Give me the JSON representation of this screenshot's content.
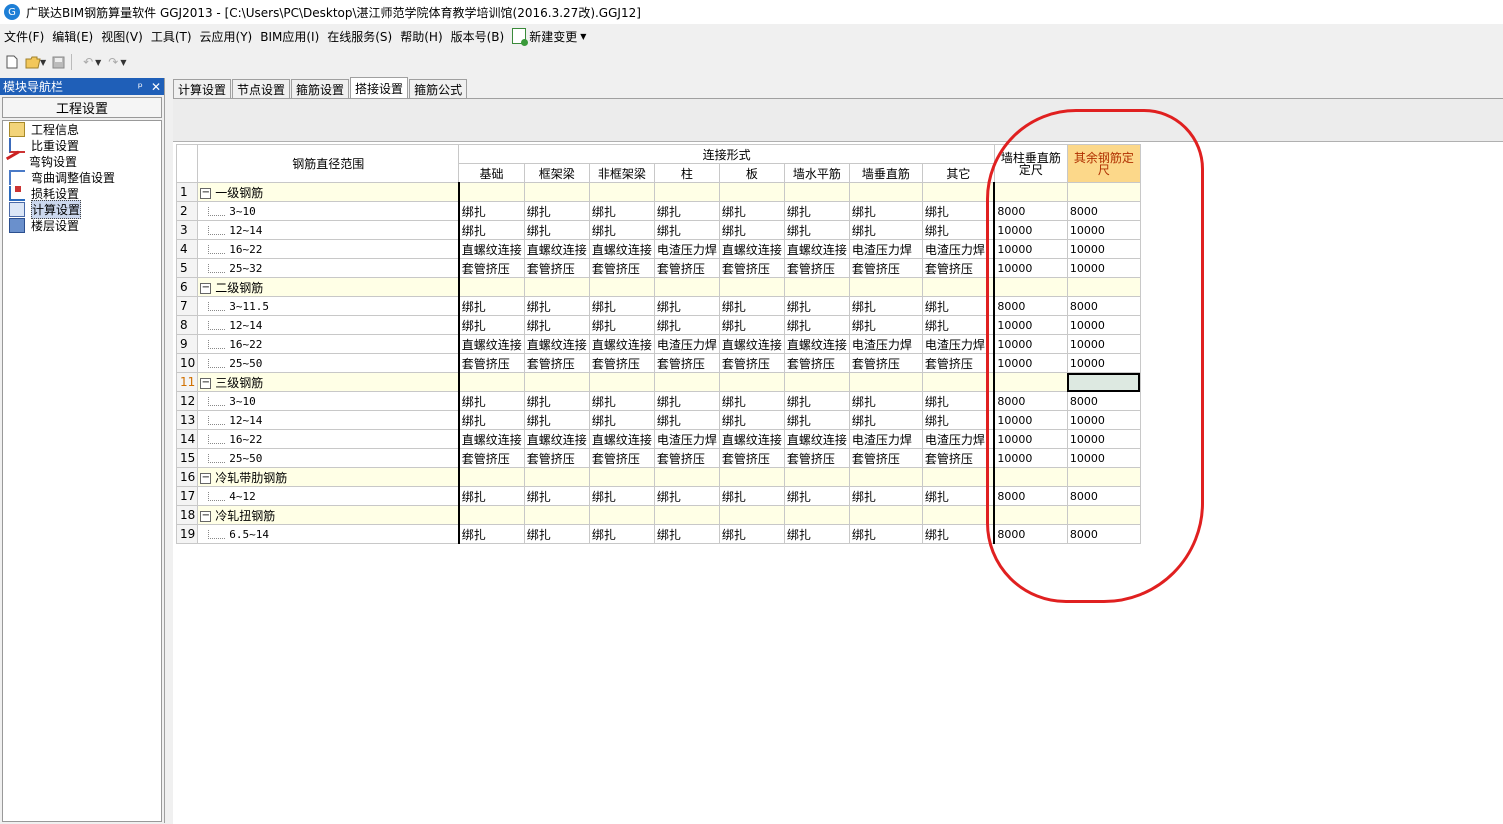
{
  "window": {
    "title": "广联达BIM钢筋算量软件 GGJ2013 - [C:\\Users\\PC\\Desktop\\湛江师范学院体育教学培训馆(2016.3.27改).GGJ12]",
    "app_icon_text": "G"
  },
  "menu": {
    "items": [
      "文件(F)",
      "编辑(E)",
      "视图(V)",
      "工具(T)",
      "云应用(Y)",
      "BIM应用(I)",
      "在线服务(S)",
      "帮助(H)",
      "版本号(B)"
    ],
    "new_change": "新建变更"
  },
  "toolbar": {
    "new_icon": "new-file-icon",
    "open_icon": "open-folder-icon",
    "save_icon": "save-icon",
    "undo_icon": "undo-icon",
    "redo_icon": "redo-icon"
  },
  "nav": {
    "title": "模块导航栏",
    "pin": "ᵖ",
    "close": "✕",
    "section": "工程设置",
    "items": [
      "工程信息",
      "比重设置",
      "弯钩设置",
      "弯曲调整值设置",
      "损耗设置",
      "计算设置",
      "楼层设置"
    ],
    "selected_index": 5
  },
  "tabs": [
    "计算设置",
    "节点设置",
    "箍筋设置",
    "搭接设置",
    "箍筋公式"
  ],
  "active_tab": 3,
  "table": {
    "header_range": "钢筋直径范围",
    "header_group": "连接形式",
    "cols": [
      "基础",
      "框架梁",
      "非框架梁",
      "柱",
      "板",
      "墙水平筋",
      "墙垂直筋",
      "其它"
    ],
    "col_wall_fixed": "墙柱垂直筋定尺",
    "col_other_fixed": "其余钢筋定尺",
    "rows": [
      {
        "n": "1",
        "group": true,
        "name": "一级钢筋",
        "v": [
          "",
          "",
          "",
          "",
          "",
          "",
          "",
          ""
        ],
        "a": "",
        "b": ""
      },
      {
        "n": "2",
        "group": false,
        "name": "3~10",
        "v": [
          "绑扎",
          "绑扎",
          "绑扎",
          "绑扎",
          "绑扎",
          "绑扎",
          "绑扎",
          "绑扎"
        ],
        "a": "8000",
        "b": "8000"
      },
      {
        "n": "3",
        "group": false,
        "name": "12~14",
        "v": [
          "绑扎",
          "绑扎",
          "绑扎",
          "绑扎",
          "绑扎",
          "绑扎",
          "绑扎",
          "绑扎"
        ],
        "a": "10000",
        "b": "10000"
      },
      {
        "n": "4",
        "group": false,
        "name": "16~22",
        "v": [
          "直螺纹连接",
          "直螺纹连接",
          "直螺纹连接",
          "电渣压力焊",
          "直螺纹连接",
          "直螺纹连接",
          "电渣压力焊",
          "电渣压力焊"
        ],
        "a": "10000",
        "b": "10000"
      },
      {
        "n": "5",
        "group": false,
        "name": "25~32",
        "v": [
          "套管挤压",
          "套管挤压",
          "套管挤压",
          "套管挤压",
          "套管挤压",
          "套管挤压",
          "套管挤压",
          "套管挤压"
        ],
        "a": "10000",
        "b": "10000"
      },
      {
        "n": "6",
        "group": true,
        "name": "二级钢筋",
        "v": [
          "",
          "",
          "",
          "",
          "",
          "",
          "",
          ""
        ],
        "a": "",
        "b": ""
      },
      {
        "n": "7",
        "group": false,
        "name": "3~11.5",
        "v": [
          "绑扎",
          "绑扎",
          "绑扎",
          "绑扎",
          "绑扎",
          "绑扎",
          "绑扎",
          "绑扎"
        ],
        "a": "8000",
        "b": "8000"
      },
      {
        "n": "8",
        "group": false,
        "name": "12~14",
        "v": [
          "绑扎",
          "绑扎",
          "绑扎",
          "绑扎",
          "绑扎",
          "绑扎",
          "绑扎",
          "绑扎"
        ],
        "a": "10000",
        "b": "10000"
      },
      {
        "n": "9",
        "group": false,
        "name": "16~22",
        "v": [
          "直螺纹连接",
          "直螺纹连接",
          "直螺纹连接",
          "电渣压力焊",
          "直螺纹连接",
          "直螺纹连接",
          "电渣压力焊",
          "电渣压力焊"
        ],
        "a": "10000",
        "b": "10000"
      },
      {
        "n": "10",
        "group": false,
        "name": "25~50",
        "v": [
          "套管挤压",
          "套管挤压",
          "套管挤压",
          "套管挤压",
          "套管挤压",
          "套管挤压",
          "套管挤压",
          "套管挤压"
        ],
        "a": "10000",
        "b": "10000"
      },
      {
        "n": "11",
        "group": true,
        "name": "三级钢筋",
        "v": [
          "",
          "",
          "",
          "",
          "",
          "",
          "",
          ""
        ],
        "a": "",
        "b": "",
        "selected": true
      },
      {
        "n": "12",
        "group": false,
        "name": "3~10",
        "v": [
          "绑扎",
          "绑扎",
          "绑扎",
          "绑扎",
          "绑扎",
          "绑扎",
          "绑扎",
          "绑扎"
        ],
        "a": "8000",
        "b": "8000"
      },
      {
        "n": "13",
        "group": false,
        "name": "12~14",
        "v": [
          "绑扎",
          "绑扎",
          "绑扎",
          "绑扎",
          "绑扎",
          "绑扎",
          "绑扎",
          "绑扎"
        ],
        "a": "10000",
        "b": "10000"
      },
      {
        "n": "14",
        "group": false,
        "name": "16~22",
        "v": [
          "直螺纹连接",
          "直螺纹连接",
          "直螺纹连接",
          "电渣压力焊",
          "直螺纹连接",
          "直螺纹连接",
          "电渣压力焊",
          "电渣压力焊"
        ],
        "a": "10000",
        "b": "10000"
      },
      {
        "n": "15",
        "group": false,
        "name": "25~50",
        "v": [
          "套管挤压",
          "套管挤压",
          "套管挤压",
          "套管挤压",
          "套管挤压",
          "套管挤压",
          "套管挤压",
          "套管挤压"
        ],
        "a": "10000",
        "b": "10000"
      },
      {
        "n": "16",
        "group": true,
        "name": "冷轧带肋钢筋",
        "v": [
          "",
          "",
          "",
          "",
          "",
          "",
          "",
          ""
        ],
        "a": "",
        "b": ""
      },
      {
        "n": "17",
        "group": false,
        "name": "4~12",
        "v": [
          "绑扎",
          "绑扎",
          "绑扎",
          "绑扎",
          "绑扎",
          "绑扎",
          "绑扎",
          "绑扎"
        ],
        "a": "8000",
        "b": "8000"
      },
      {
        "n": "18",
        "group": true,
        "name": "冷轧扭钢筋",
        "v": [
          "",
          "",
          "",
          "",
          "",
          "",
          "",
          ""
        ],
        "a": "",
        "b": ""
      },
      {
        "n": "19",
        "group": false,
        "name": "6.5~14",
        "v": [
          "绑扎",
          "绑扎",
          "绑扎",
          "绑扎",
          "绑扎",
          "绑扎",
          "绑扎",
          "绑扎"
        ],
        "a": "8000",
        "b": "8000"
      }
    ]
  },
  "colors": {
    "nav_header": "#1f5fb8",
    "highlight_header": "#fcd88a",
    "annotation": "#e02020",
    "group_row": "#ffffe6"
  }
}
